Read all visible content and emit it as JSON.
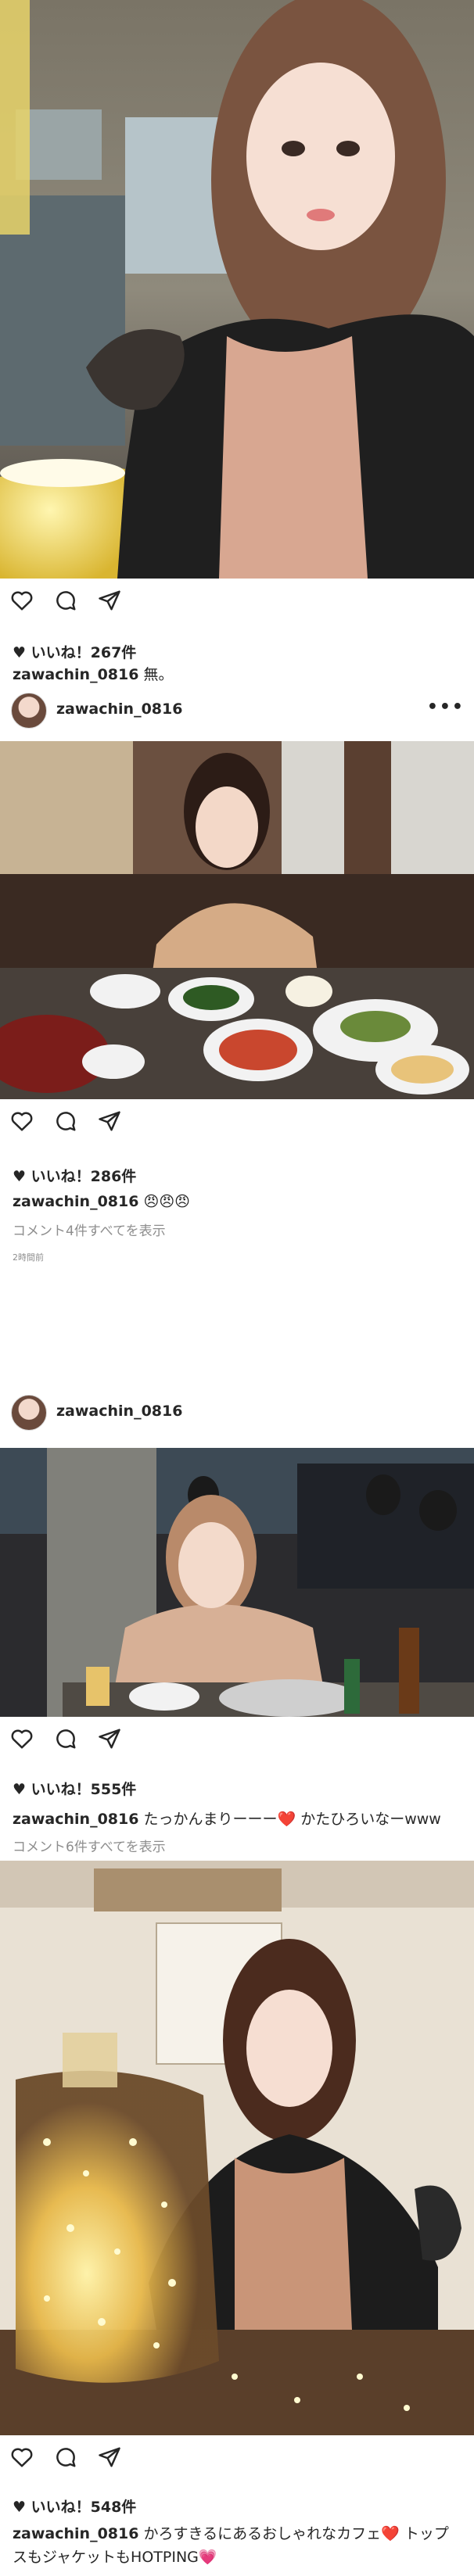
{
  "posts": [
    {
      "likes": "♥ いいね！267件",
      "username": "zawachin_0816",
      "caption": "無。"
    },
    {
      "header_username": "zawachin_0816",
      "likes": "♥ いいね！286件",
      "username": "zawachin_0816",
      "caption": "😠😠😠",
      "comments": "コメント4件すべてを表示",
      "time": "2時間前"
    },
    {
      "header_username": "zawachin_0816",
      "likes": "♥ いいね！555件",
      "username": "zawachin_0816",
      "caption": "たっかんまりーーー❤️ かたひろいなーwww",
      "comments": "コメント6件すべてを表示"
    },
    {
      "likes": "♥ いいね！548件",
      "username": "zawachin_0816",
      "caption": "かろすきるにあるおしゃれなカフェ❤️ トップスもジャケットもHOTPING💗"
    }
  ],
  "menu_icon": "more-dots",
  "icons": [
    "heart-icon",
    "comment-icon",
    "share-icon",
    "more-icon"
  ],
  "colors": {
    "text": "#262626",
    "secondary": "#8e8e8e",
    "background": "#ffffff"
  }
}
